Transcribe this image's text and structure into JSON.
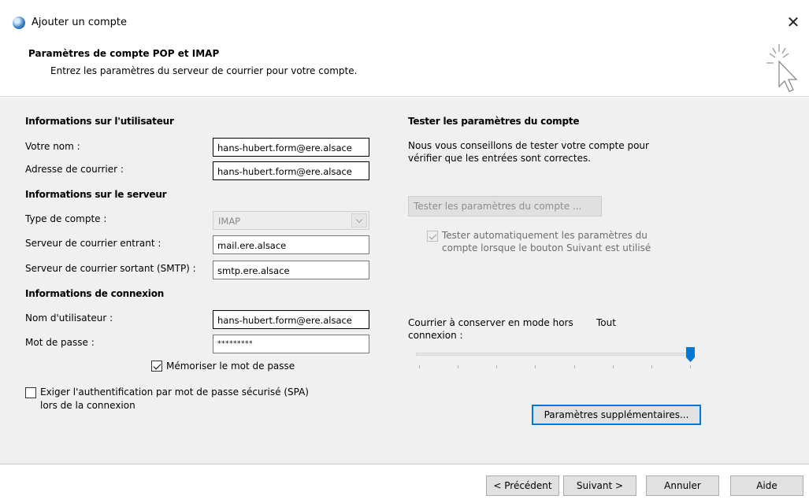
{
  "window": {
    "title": "Ajouter un compte",
    "close_icon": "close-icon"
  },
  "header": {
    "title": "Paramètres de compte POP et IMAP",
    "subtitle": "Entrez les paramètres du serveur de courrier pour votre compte."
  },
  "user_info": {
    "heading": "Informations sur l'utilisateur",
    "name_label": "Votre nom :",
    "name_value": "hans-hubert.form@ere.alsace",
    "email_label": "Adresse de courrier :",
    "email_value": "hans-hubert.form@ere.alsace"
  },
  "server_info": {
    "heading": "Informations sur le serveur",
    "account_type_label": "Type de compte :",
    "account_type_value": "IMAP",
    "incoming_label": "Serveur de courrier entrant :",
    "incoming_value": "mail.ere.alsace",
    "outgoing_label": "Serveur de courrier sortant (SMTP) :",
    "outgoing_value": "smtp.ere.alsace"
  },
  "login_info": {
    "heading": "Informations de connexion",
    "username_label": "Nom d'utilisateur :",
    "username_value": "hans-hubert.form@ere.alsace",
    "password_label": "Mot de passe :",
    "password_value": "*********",
    "remember_label": "Mémoriser le mot de passe",
    "remember_checked": true,
    "spa_label_line1": "Exiger l'authentification par mot de passe sécurisé (SPA)",
    "spa_label_line2": "lors de la connexion",
    "spa_checked": false
  },
  "test_settings": {
    "heading": "Tester les paramètres du compte",
    "description_line1": "Nous vous conseillons de tester votre compte pour",
    "description_line2": "vérifier que les entrées sont correctes.",
    "test_button": "Tester les paramètres du compte ...",
    "auto_test_line1": "Tester automatiquement les paramètres du",
    "auto_test_line2": "compte lorsque le bouton Suivant est utilisé",
    "auto_test_checked": true
  },
  "offline": {
    "label_line1": "Courrier à conserver en mode hors",
    "label_line2": "connexion :",
    "value": "Tout",
    "slider_fraction": 1.0
  },
  "more_settings_button": "Paramètres supplémentaires...",
  "footer": {
    "back": "< Précédent",
    "next": "Suivant >",
    "cancel": "Annuler",
    "help": "Aide"
  },
  "colors": {
    "accent": "#0078d7",
    "panel_bg": "#f0f0f0"
  }
}
